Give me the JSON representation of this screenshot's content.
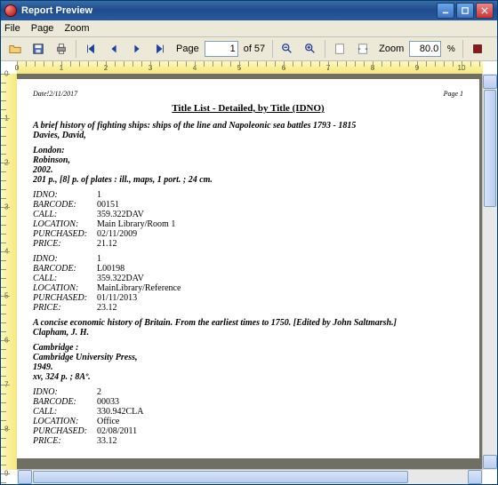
{
  "window": {
    "title": "Report Preview"
  },
  "menu": {
    "file": "File",
    "page": "Page",
    "zoom": "Zoom"
  },
  "toolbar": {
    "page_label": "Page",
    "page_value": "1",
    "of_label": "of 57",
    "zoom_label": "Zoom",
    "zoom_value": "80.0",
    "pct": "%"
  },
  "report": {
    "date_label": "Date!",
    "date": "2/11/2017",
    "page_label": "Page",
    "page_no": "1",
    "title": "Title List - Detailed, by Title (IDNO)",
    "entries": [
      {
        "title": "A brief history of fighting ships: ships of the line and Napoleonic sea battles 1793 - 1815",
        "author": "Davies, David,",
        "pub1": "London:",
        "pub2": "Robinson,",
        "pub3": "2002.",
        "coll": "201 p., [8] p. of plates : ill., maps, 1 port. ;  24 cm.",
        "copies": [
          {
            "idno": "1",
            "barcode": "00151",
            "call": "359.322DAV",
            "location": "Main Library/Room 1",
            "purchased": "02/11/2009",
            "price": "21.12"
          },
          {
            "idno": "1",
            "barcode": "L00198",
            "call": "359.322DAV",
            "location": "MainLibrary/Reference",
            "purchased": "01/11/2013",
            "price": "23.12"
          }
        ]
      },
      {
        "title": "A concise economic history of Britain. From the earliest times to 1750. [Edited by John Saltmarsh.]",
        "author": "Clapham, J. H.",
        "pub1": "Cambridge :",
        "pub2": "Cambridge University Press,",
        "pub3": "1949.",
        "coll": "xv, 324 p. ;  8Aº.",
        "copies": [
          {
            "idno": "2",
            "barcode": "00033",
            "call": "330.942CLA",
            "location": "Office",
            "purchased": "02/08/2011",
            "price": "33.12"
          }
        ]
      }
    ],
    "labels": {
      "idno": "IDNO:",
      "barcode": "BARCODE:",
      "call": "CALL:",
      "location": "LOCATION:",
      "purchased": "PURCHASED:",
      "price": "PRICE:"
    }
  }
}
